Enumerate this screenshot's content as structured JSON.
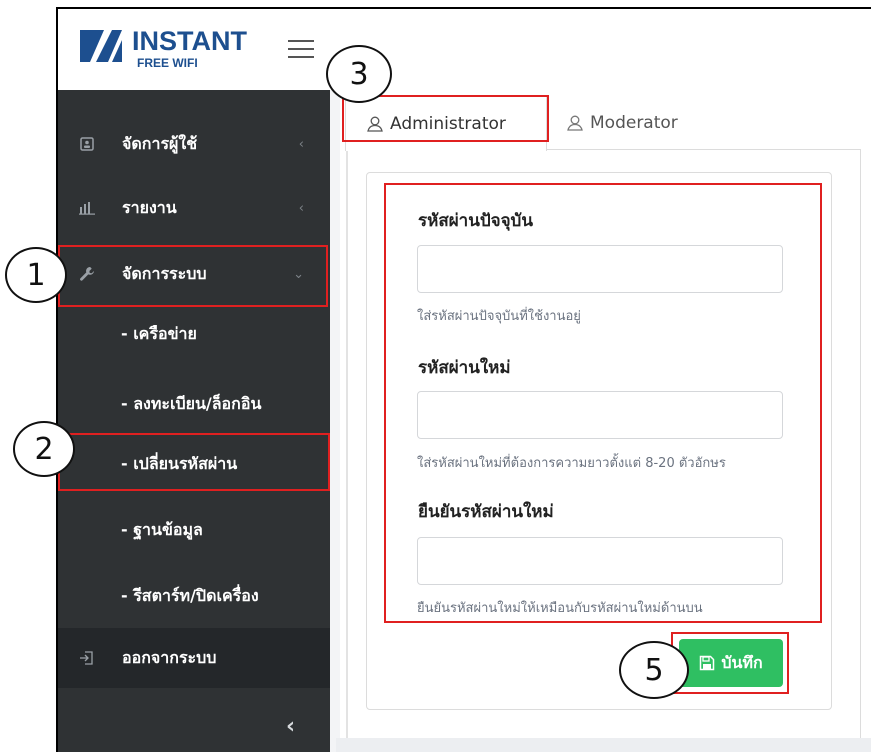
{
  "header": {
    "logo_word": "INSTANT",
    "logo_sub": "FREE WIFI"
  },
  "sidebar": {
    "items": [
      {
        "name": "sidebar-item-users",
        "label": "จัดการผู้ใช้",
        "icon": "id-card-icon"
      },
      {
        "name": "sidebar-item-reports",
        "label": "รายงาน",
        "icon": "bar-chart-icon"
      },
      {
        "name": "sidebar-item-system",
        "label": "จัดการระบบ",
        "icon": "wrench-icon"
      }
    ],
    "submenu": [
      {
        "label": "- เครือข่าย"
      },
      {
        "label": "- ลงทะเบียน/ล็อกอิน"
      },
      {
        "label": "- เปลี่ยนรหัสผ่าน"
      },
      {
        "label": "- ฐานข้อมูล"
      },
      {
        "label": "- รีสตาร์ท/ปิดเครื่อง"
      }
    ],
    "logout": {
      "label": "ออกจากระบบ",
      "icon": "logout-icon"
    }
  },
  "tabs": [
    {
      "label": "Administrator"
    },
    {
      "label": "Moderator"
    }
  ],
  "form": {
    "current_password": {
      "label": "รหัสผ่านปัจจุบัน",
      "value": "",
      "help": "ใส่รหัสผ่านปัจจุบันที่ใช้งานอยู่"
    },
    "new_password": {
      "label": "รหัสผ่านใหม่",
      "value": "",
      "help": "ใส่รหัสผ่านใหม่ที่ต้องการความยาวตั้งแต่ 8-20 ตัวอักษร"
    },
    "confirm_password": {
      "label": "ยืนยันรหัสผ่านใหม่",
      "value": "",
      "help": "ยืนยันรหัสผ่านใหม่ให้เหมือนกับรหัสผ่านใหม่ด้านบน"
    },
    "save_label": "บันทึก"
  },
  "annotations": {
    "step1": "1",
    "step2": "2",
    "step3": "3",
    "step5": "5"
  },
  "colors": {
    "sidebar_bg": "#2f3234",
    "save_green": "#2fbf62",
    "annotation_red": "#e02020",
    "logo_blue": "#1d4f8f"
  }
}
